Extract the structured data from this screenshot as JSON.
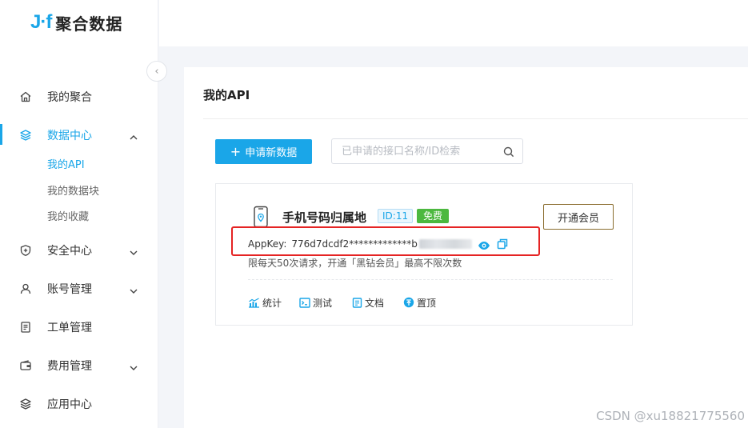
{
  "brand": {
    "logo_mark": "J·f",
    "name": "聚合数据"
  },
  "sidebar": {
    "collapse_glyph": "‹",
    "items": [
      {
        "label": "我的聚合",
        "icon": "home-icon"
      },
      {
        "label": "数据中心",
        "icon": "layers-icon",
        "expanded": true,
        "children": [
          {
            "label": "我的API",
            "active": true
          },
          {
            "label": "我的数据块"
          },
          {
            "label": "我的收藏"
          }
        ]
      },
      {
        "label": "安全中心",
        "icon": "shield-icon"
      },
      {
        "label": "账号管理",
        "icon": "user-icon"
      },
      {
        "label": "工单管理",
        "icon": "ticket-icon"
      },
      {
        "label": "费用管理",
        "icon": "wallet-icon"
      },
      {
        "label": "应用中心",
        "icon": "apps-icon"
      }
    ]
  },
  "main": {
    "title": "我的API",
    "add_button": {
      "plus": "+",
      "label": "申请新数据"
    },
    "search": {
      "placeholder": "已申请的接口名称/ID检索",
      "value": ""
    },
    "card": {
      "name": "手机号码归属地",
      "id_tag": "ID:11",
      "free_tag": "免费",
      "vip_button": "开通会员",
      "appkey_label": "AppKey:",
      "appkey_value": "776d7dcdf2*************b",
      "limit_text": "限每天50次请求，开通「黑钻会员」最高不限次数",
      "actions": [
        {
          "label": "统计",
          "icon": "chart-icon"
        },
        {
          "label": "测试",
          "icon": "terminal-icon"
        },
        {
          "label": "文档",
          "icon": "document-icon"
        },
        {
          "label": "置顶",
          "icon": "pin-top-icon"
        }
      ]
    }
  },
  "watermark": "CSDN @xu18821775560",
  "colors": {
    "accent": "#1aa6e8",
    "free": "#4cb83f",
    "highlight": "#e52424",
    "vip_border": "#8a6d2f"
  }
}
